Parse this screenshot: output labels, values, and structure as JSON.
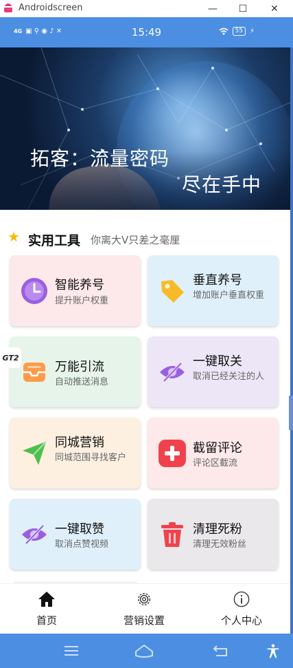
{
  "window": {
    "title": "Androidscreen",
    "minimize": "—",
    "maximize": "☐",
    "close": "✕"
  },
  "statusbar": {
    "time": "15:49",
    "network": "4G",
    "battery": "55"
  },
  "banner": {
    "line1": "拓客：流量密码",
    "line2": "尽在手中"
  },
  "side_tab": "GT2",
  "section": {
    "title": "实用工具",
    "subtitle": "你离大V只差之毫厘"
  },
  "cards": [
    {
      "title": "智能养号",
      "desc": "提升账户权重",
      "bg": "#fde8ea",
      "icon": "clock-icon",
      "color": "#8a4fd8"
    },
    {
      "title": "垂直养号",
      "desc": "增加账户垂直权重",
      "bg": "#dff0fb",
      "icon": "tag-icon",
      "color": "#f5b520"
    },
    {
      "title": "万能引流",
      "desc": "自动推送消息",
      "bg": "#e6f4ea",
      "icon": "inbox-icon",
      "color": "#ff8c3a"
    },
    {
      "title": "一键取关",
      "desc": "取消已经关注的人",
      "bg": "#ece6f6",
      "icon": "eye-off-icon",
      "color": "#8a4fd8"
    },
    {
      "title": "同城营销",
      "desc": "同城范围寻找客户",
      "bg": "#fdf0e0",
      "icon": "send-icon",
      "color": "#4cc04c"
    },
    {
      "title": "截留评论",
      "desc": "评论区截流",
      "bg": "#fde8ea",
      "icon": "plus-square-icon",
      "color": "#f0424d"
    },
    {
      "title": "一键取赞",
      "desc": "取消点赞视频",
      "bg": "#dff0fb",
      "icon": "eye-off-icon",
      "color": "#8a4fd8"
    },
    {
      "title": "清理死粉",
      "desc": "清理无效粉丝",
      "bg": "#eae8ea",
      "icon": "trash-icon",
      "color": "#f0424d"
    }
  ],
  "bottomnav": [
    {
      "label": "首页",
      "icon": "home-icon"
    },
    {
      "label": "营销设置",
      "icon": "settings-icon"
    },
    {
      "label": "个人中心",
      "icon": "info-icon"
    }
  ]
}
